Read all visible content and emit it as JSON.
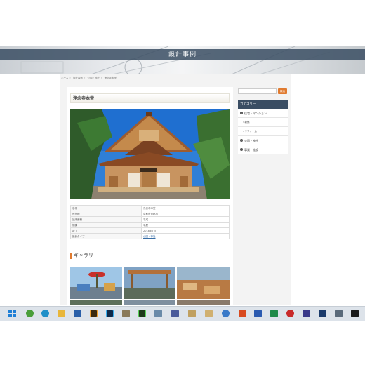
{
  "banner": {
    "title": "設計事例"
  },
  "breadcrumb": [
    "ホーム",
    "設計事例",
    "公園・神社",
    "浄念寺本堂"
  ],
  "post": {
    "title": "浄念寺本堂",
    "info": [
      {
        "key": "名称",
        "value": "浄念寺本堂"
      },
      {
        "key": "所在地",
        "value": "京都府京都市"
      },
      {
        "key": "延床面積",
        "value": "平成"
      },
      {
        "key": "規模",
        "value": "平屋"
      },
      {
        "key": "竣工",
        "value": "2018年7月"
      },
      {
        "key": "設計タイプ",
        "value": "公園・神社"
      }
    ]
  },
  "gallery": {
    "heading": "ギャラリー"
  },
  "sidebar": {
    "search_placeholder": "",
    "search_button": "検索",
    "category_header": "カテゴリー",
    "categories": [
      {
        "label": "住宅・マンション",
        "sub": false
      },
      {
        "label": "新築",
        "sub": true
      },
      {
        "label": "リフォーム",
        "sub": true
      },
      {
        "label": "公園・神社",
        "sub": false
      },
      {
        "label": "事業・施設",
        "sub": false
      }
    ]
  },
  "taskbar": {
    "icons": [
      "windows-start",
      "edge-browser",
      "chrome-browser",
      "edge-browser-2",
      "file-explorer",
      "store",
      "illustrator",
      "photoshop",
      "gimp",
      "dreamweaver",
      "terminal",
      "media",
      "paint",
      "settings",
      "app-orange",
      "powerpoint",
      "word",
      "excel",
      "app-red",
      "media-player",
      "word-2",
      "calculator",
      "terminal-2"
    ]
  }
}
